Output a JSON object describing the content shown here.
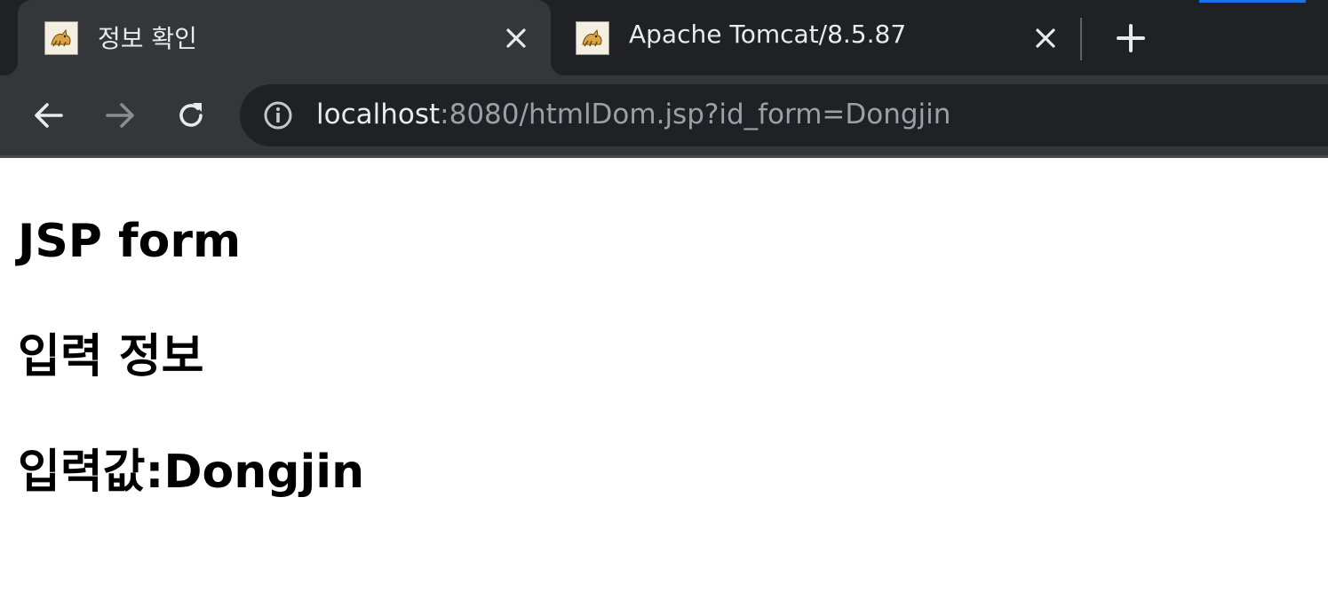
{
  "browser": {
    "tabs": [
      {
        "title": "정보 확인",
        "active": true,
        "favicon": "tomcat-icon"
      },
      {
        "title": "Apache Tomcat/8.5.87",
        "active": false,
        "favicon": "tomcat-icon"
      }
    ],
    "new_tab_icon": "plus-icon",
    "close_icon": "close-icon",
    "nav": {
      "back_icon": "arrow-left-icon",
      "forward_icon": "arrow-right-icon",
      "reload_icon": "reload-icon"
    },
    "address_bar": {
      "icon": "info-icon",
      "host": "localhost",
      "rest": ":8080/htmlDom.jsp?id_form=Dongjin"
    },
    "colors": {
      "tabstrip": "#202124",
      "toolbar": "#35363a",
      "text": "#e8eaed",
      "muted": "#9aa0a6"
    }
  },
  "page": {
    "title": "JSP form",
    "section": "입력 정보",
    "value_line": "입력값:Dongjin"
  }
}
